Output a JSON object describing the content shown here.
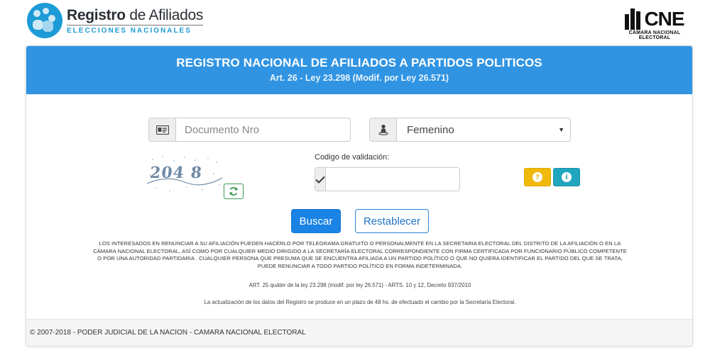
{
  "brand": {
    "title_bold": "Registro",
    "title_rest": " de Afiliados",
    "subtitle": "ELECCIONES NACIONALES",
    "logo_icon": "people-circle-icon",
    "right_logo_word": "CNE",
    "right_logo_sub": "CÁMARA NACIONAL ELECTORAL"
  },
  "header": {
    "title": "REGISTRO NACIONAL DE AFILIADOS A PARTIDOS POLITICOS",
    "subtitle": "Art. 26 - Ley 23.298 (Modif. por Ley 26.571)",
    "color": "#3094e2"
  },
  "form": {
    "document": {
      "placeholder": "Documento Nro",
      "value": "",
      "icon": "id-card-icon"
    },
    "gender": {
      "selected": "Femenino",
      "icon": "person-icon"
    },
    "captcha_text": "204 8",
    "code_label": "Codigo de validación:",
    "code_value": "",
    "code_icon": "check-icon",
    "help_icon": "question-icon",
    "info_icon": "info-icon",
    "refresh_icon": "refresh-icon"
  },
  "actions": {
    "search_label": "Buscar",
    "reset_label": "Restablecer"
  },
  "legal": {
    "notice": "LOS INTERESADOS EN RENUNCIAR A SU AFILIACIÓN PUEDEN HACERLO POR TELEGRAMA GRATUITO O PERSONALMENTE EN LA SECRETARIA ELECTORAL DEL DISTRITO DE LA AFILIACIÓN O EN LA CÁMARA NACIONAL ELECTORAL, ASÍ COMO POR CUALQUIER MEDIO DIRIGIDO A LA SECRETARÍA ELECTORAL CORRESPONDIENTE CON FIRMA CERTIFICADA POR FUNCIONARIO PÚBLICO COMPETENTE O POR UNA AUTORIDAD PARTIDARIA . CUALQUIER PERSONA QUE PRESUMA QUE SE ENCUENTRA AFILIADA A UN PARTIDO POLÍTICO O QUE NO QUIERA IDENTIFICAR EL PARTIDO DEL QUE SE TRATA, PUEDE RENUNCIAR A TODO PARTIDO POLÍTICO EN FORMA INDETERMINADA.",
    "article": "ART. 25 quáter de la ley 23.298 (modif. por ley 26.571) - ARTS. 10 y 12, Decreto 937/2010",
    "update": "La actualización de los datos del Registro se produce en un plazo de 48 hs. de efectuado el cambio por la Secretaría Electoral."
  },
  "footer": {
    "text": "© 2007-2018 - PODER JUDICIAL DE LA NACION - CAMARA NACIONAL ELECTORAL"
  }
}
